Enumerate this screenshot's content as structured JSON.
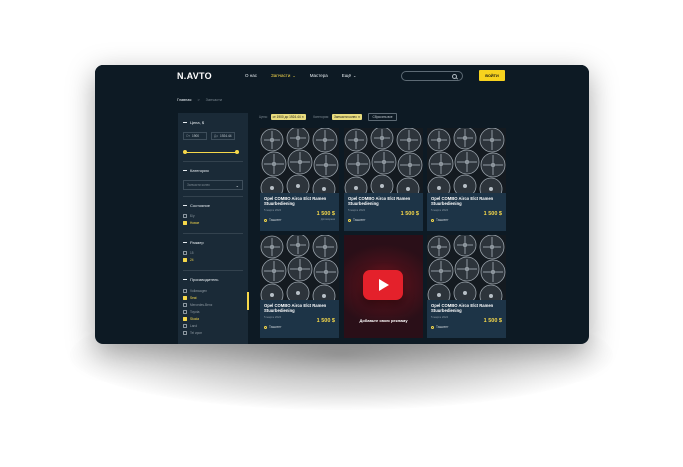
{
  "header": {
    "logo": "N.AVTO",
    "nav": [
      {
        "label": "О нас",
        "active": false,
        "dropdown": false
      },
      {
        "label": "Запчасти",
        "active": true,
        "dropdown": true
      },
      {
        "label": "Мастера",
        "active": false,
        "dropdown": false
      },
      {
        "label": "Ещё",
        "active": false,
        "dropdown": true
      }
    ],
    "search_placeholder": "",
    "login_label": "ВОЙТИ"
  },
  "breadcrumbs": {
    "home": "Главная",
    "separator": ">",
    "current": "Запчасти"
  },
  "sidebar": {
    "price": {
      "title": "Цена, $",
      "from_label": "От",
      "from_value": "1900",
      "to_label": "До",
      "to_value": "1924.44"
    },
    "category": {
      "title": "Категория",
      "select_value": "Запчасти колес"
    },
    "condition": {
      "title": "Состояние",
      "options": [
        {
          "label": "Б/у",
          "checked": false
        },
        {
          "label": "Новое",
          "checked": true
        }
      ]
    },
    "size": {
      "title": "Размер",
      "options": [
        {
          "label": "15",
          "checked": false
        },
        {
          "label": "24",
          "checked": true
        }
      ]
    },
    "manufacturer": {
      "title": "Производитель",
      "options": [
        {
          "label": "Volkswagen",
          "checked": false
        },
        {
          "label": "Seat",
          "checked": true
        },
        {
          "label": "Mercedes-Benz",
          "checked": false
        },
        {
          "label": "Toyota",
          "checked": false
        },
        {
          "label": "Skoda",
          "checked": true
        },
        {
          "label": "Land",
          "checked": false
        },
        {
          "label": "Tel ирон",
          "checked": false
        }
      ]
    }
  },
  "filters": {
    "price_label": "Цена:",
    "price_chip": "от 1900 до 1924.44 ✕",
    "category_label": "Категория:",
    "category_chip": "Запчасти колес ✕",
    "reset_label": "Сбросить все"
  },
  "cards": [
    {
      "title": "Opel COMBO Airco Elct Ramen Stuurbediening",
      "date": "5 марта 2024",
      "price": "1 500 $",
      "sub": "Договорная",
      "location": "Ташкент"
    },
    {
      "title": "Opel COMBO Airco Elct Ramen Stuurbediening",
      "date": "5 марта 2024",
      "price": "1 500 $",
      "sub": "",
      "location": "Ташкент"
    },
    {
      "title": "Opel COMBO Airco Elct Ramen Stuurbediening",
      "date": "5 марта 2024",
      "price": "1 500 $",
      "sub": "",
      "location": "Ташкент"
    },
    {
      "title": "Opel COMBO Airco Elct Ramen Stuurbediening",
      "date": "5 марта 2024",
      "price": "1 500 $",
      "sub": "",
      "location": "Ташкент"
    },
    {
      "title": "Opel COMBO Airco Elct Ramen Stuurbediening",
      "date": "5 марта 2024",
      "price": "1 500 $",
      "sub": "",
      "location": "Ташкент"
    }
  ],
  "ad": {
    "text": "Добавьте свою рекламу"
  },
  "colors": {
    "background": "#0d1a24",
    "accent": "#f6d84a",
    "card": "#1d3447",
    "sidebar": "#1a2a37",
    "ad_red": "#e4212b"
  },
  "icons": {
    "search": "search-icon",
    "chevron": "chevron-down-icon",
    "location": "location-pin-icon",
    "play": "youtube-play-icon"
  }
}
